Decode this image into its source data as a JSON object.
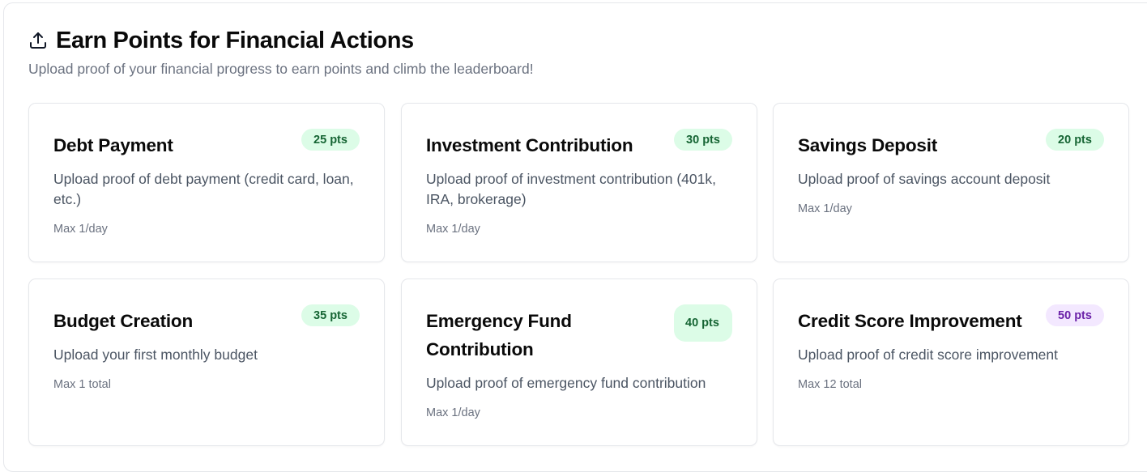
{
  "header": {
    "title": "Earn Points for Financial Actions",
    "subtitle": "Upload proof of your financial progress to earn points and climb the leaderboard!"
  },
  "cards": [
    {
      "title": "Debt Payment",
      "points": "25 pts",
      "description": "Upload proof of debt payment (credit card, loan, etc.)",
      "limit": "Max 1/day",
      "badge_color": "#dcfce7"
    },
    {
      "title": "Investment Contribution",
      "points": "30 pts",
      "description": "Upload proof of investment contribution (401k, IRA, brokerage)",
      "limit": "Max 1/day",
      "badge_color": "#dcfce7"
    },
    {
      "title": "Savings Deposit",
      "points": "20 pts",
      "description": "Upload proof of savings account deposit",
      "limit": "Max 1/day",
      "badge_color": "#dcfce7"
    },
    {
      "title": "Budget Creation",
      "points": "35 pts",
      "description": "Upload your first monthly budget",
      "limit": "Max 1 total",
      "badge_color": "#dcfce7"
    },
    {
      "title": "Emergency Fund Contribution",
      "points": "40 pts",
      "description": "Upload proof of emergency fund contribution",
      "limit": "Max 1/day",
      "badge_color": "#dcfce7"
    },
    {
      "title": "Credit Score Improvement",
      "points": "50 pts",
      "description": "Upload proof of credit score improvement",
      "limit": "Max 12 total",
      "badge_color": "#f3e8ff"
    }
  ]
}
